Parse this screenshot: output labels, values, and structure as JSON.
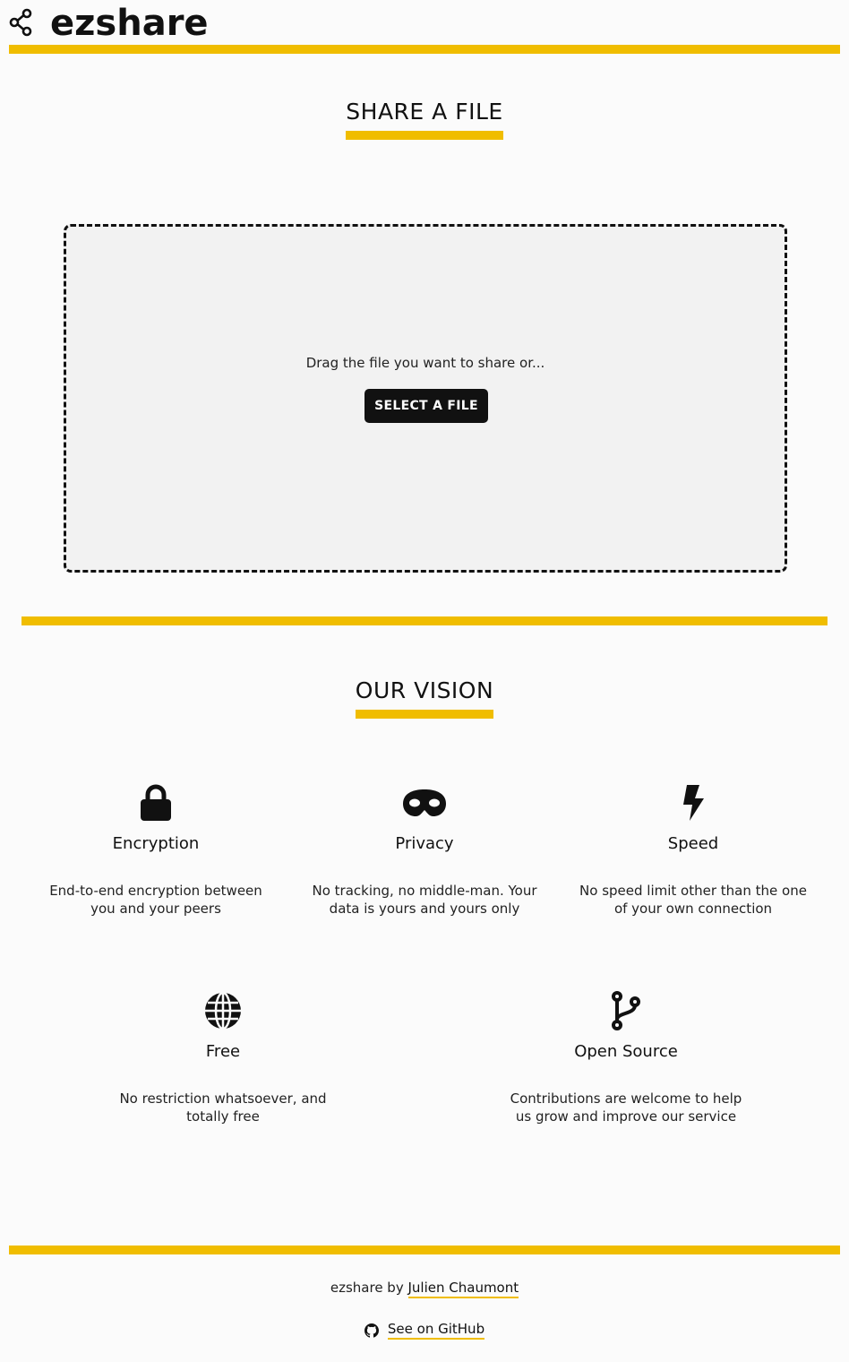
{
  "header": {
    "app_name": "ezshare",
    "logo_icon": "share-nodes-icon"
  },
  "share": {
    "title": "SHARE A FILE",
    "drop_text": "Drag the file you want to share or...",
    "select_button": "SELECT A FILE"
  },
  "vision": {
    "title": "OUR VISION",
    "features": [
      {
        "icon": "lock-icon",
        "title": "Encryption",
        "desc_line1": "End-to-end encryption between",
        "desc_line2": "you and your peers"
      },
      {
        "icon": "mask-icon",
        "title": "Privacy",
        "desc_line1": "No tracking, no middle-man. Your",
        "desc_line2": "data is yours and yours only"
      },
      {
        "icon": "bolt-icon",
        "title": "Speed",
        "desc_line1": "No speed limit other than the one",
        "desc_line2": "of your own connection"
      },
      {
        "icon": "globe-icon",
        "title": "Free",
        "desc_line1": "No restriction whatsoever, and",
        "desc_line2": "totally free"
      },
      {
        "icon": "code-branch-icon",
        "title": "Open Source",
        "desc_line1": "Contributions are welcome to help",
        "desc_line2": "us grow and improve our service"
      }
    ]
  },
  "footer": {
    "credit_prefix": "ezshare by",
    "author_link": "Julien Chaumont",
    "github_link": "See on GitHub",
    "github_icon": "github-icon"
  },
  "colors": {
    "accent": "#f0bd00",
    "dark": "#111111",
    "dropzone_bg": "#f2f2f2"
  }
}
